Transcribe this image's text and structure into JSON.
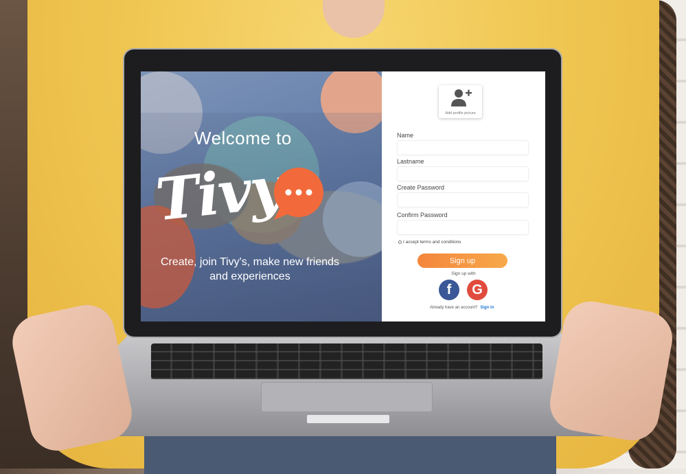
{
  "hero": {
    "welcome": "Welcome to",
    "brand": "Tivy",
    "tagline_line1": "Create, join Tivy's, make new friends",
    "tagline_line2": "and experiences",
    "accent_color": "#f26a3b"
  },
  "form": {
    "avatar_caption": "Add profile picture",
    "fields": [
      {
        "label": "Name",
        "value": ""
      },
      {
        "label": "Lastname",
        "value": ""
      },
      {
        "label": "Create Password",
        "value": ""
      },
      {
        "label": "Confirm Password",
        "value": ""
      }
    ],
    "terms_label": "I accept terms and conditions",
    "signup_label": "Sign up",
    "signup_with": "Sign up with",
    "facebook_icon": "facebook-icon",
    "google_icon": "google-icon",
    "have_account": "Already have an account?",
    "signin_label": "Sign in",
    "button_gradient": [
      "#f4863c",
      "#f7a94a"
    ]
  }
}
